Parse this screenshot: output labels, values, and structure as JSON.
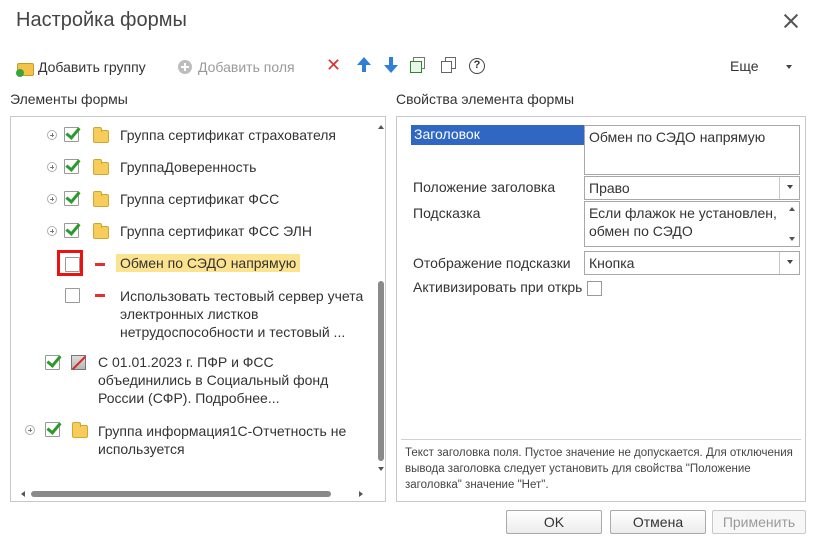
{
  "window": {
    "title": "Настройка формы"
  },
  "toolbar": {
    "add_group": "Добавить группу",
    "add_field": "Добавить поля",
    "more": "Еще"
  },
  "panels": {
    "elements_title": "Элементы формы",
    "properties_title": "Свойства элемента формы"
  },
  "tree": {
    "items": [
      {
        "label": "Группа сертификат страхователя",
        "checked": true,
        "type": "group"
      },
      {
        "label": "ГруппаДоверенность",
        "checked": true,
        "type": "group"
      },
      {
        "label": "Группа сертификат ФСС",
        "checked": true,
        "type": "group"
      },
      {
        "label": "Группа сертификат ФСС ЭЛН",
        "checked": true,
        "type": "group"
      },
      {
        "label": "Обмен по СЭДО напрямую",
        "checked": false,
        "type": "field",
        "selected": true
      },
      {
        "label_lines": [
          "Использовать тестовый сервер учета",
          "электронных листков",
          "нетрудоспособности и тестовый ..."
        ],
        "checked": false,
        "type": "field"
      },
      {
        "label_lines": [
          "С 01.01.2023 г. ПФР и ФСС",
          "объединились в Социальный фонд",
          "России (СФР). Подробнее..."
        ],
        "checked": true,
        "type": "decoration"
      },
      {
        "label_lines": [
          "Группа информация1С-Отчетность не",
          "используется"
        ],
        "checked": true,
        "type": "group"
      }
    ]
  },
  "properties": {
    "caption_label": "Заголовок",
    "caption_value": "Обмен по СЭДО напрямую",
    "caption_position_label": "Положение заголовка",
    "caption_position_value": "Право",
    "tooltip_label": "Подсказка",
    "tooltip_value_lines": [
      "Если флажок не установлен,",
      "обмен по СЭДО"
    ],
    "tooltip_display_label": "Отображение подсказки",
    "tooltip_display_value": "Кнопка",
    "activate_label": "Активизировать при откры",
    "hint_text": "Текст заголовка поля. Пустое значение не допускается. Для отключения вывода заголовка следует установить для свойства \"Положение заголовка\" значение \"Нет\"."
  },
  "buttons": {
    "ok": "OK",
    "cancel": "Отмена",
    "apply": "Применить"
  }
}
